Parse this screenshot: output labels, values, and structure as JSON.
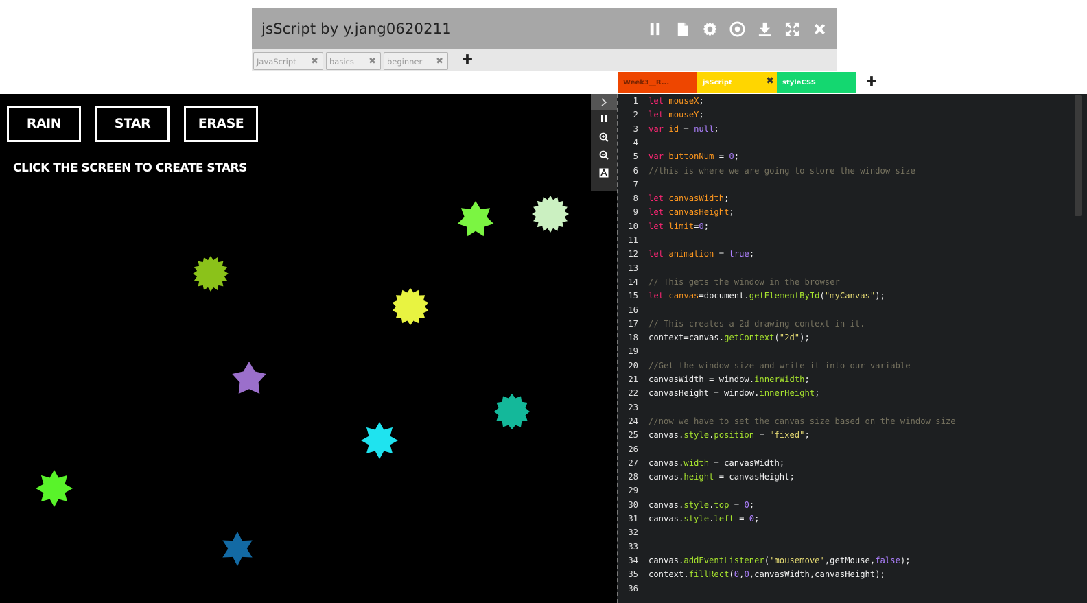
{
  "title": "jsScript by y.jang0620211",
  "title_icons": [
    "pause-icon",
    "file-icon",
    "gear-icon",
    "record-icon",
    "download-icon",
    "fullscreen-icon",
    "close-icon"
  ],
  "tags": [
    {
      "label": "JavaScript",
      "close": "✖"
    },
    {
      "label": "basics",
      "close": "✖"
    },
    {
      "label": "beginner",
      "close": "✖"
    }
  ],
  "tag_add": "✚",
  "file_tabs": [
    {
      "label": "Week3__R...",
      "color": "#ee4600",
      "close": ""
    },
    {
      "label": "jsScript",
      "color": "#ffd600",
      "close": "✖"
    },
    {
      "label": "styleCSS",
      "color": "#14d770",
      "close": ""
    }
  ],
  "file_tab_add": "✚",
  "canvas": {
    "buttons": [
      "RAIN",
      "STAR",
      "ERASE"
    ],
    "hint": "CLICK THE SCREEN TO CREATE STARS",
    "stars": [
      {
        "color": "#7bf542",
        "points": 7
      },
      {
        "color": "#cbf0c1",
        "points": 16
      },
      {
        "color": "#8bc21a",
        "points": 16
      },
      {
        "color": "#e8f341",
        "points": 14
      },
      {
        "color": "#9b6fcb",
        "points": 5
      },
      {
        "color": "#14b89a",
        "points": 12
      },
      {
        "color": "#1fe3ef",
        "points": 8
      },
      {
        "color": "#59f32a",
        "points": 8
      },
      {
        "color": "#136aa4",
        "points": 6
      }
    ]
  },
  "side_tools": [
    "collapse-icon",
    "pause-icon",
    "zoom-in-icon",
    "zoom-out-icon",
    "font-icon"
  ],
  "code_lines": [
    {
      "n": "1",
      "html": "<span class=\"kw\">let</span> <span class=\"vr\">mouseX</span>;"
    },
    {
      "n": "2",
      "html": "<span class=\"kw\">let</span> <span class=\"vr\">mouseY</span>;"
    },
    {
      "n": "3",
      "html": "<span class=\"kw\">var</span> <span class=\"vr\">id</span> = <span class=\"nm\">null</span>;"
    },
    {
      "n": "4",
      "html": ""
    },
    {
      "n": "5",
      "html": "<span class=\"kw\">var</span> <span class=\"vr\">buttonNum</span> = <span class=\"nm\">0</span>;"
    },
    {
      "n": "6",
      "html": "<span class=\"cm\">//this is where we are going to store the window size</span>"
    },
    {
      "n": "7",
      "html": ""
    },
    {
      "n": "8",
      "html": "<span class=\"kw\">let</span> <span class=\"vr\">canvasWidth</span>;"
    },
    {
      "n": "9",
      "html": "<span class=\"kw\">let</span> <span class=\"vr\">canvasHeight</span>;"
    },
    {
      "n": "10",
      "html": "<span class=\"kw\">let</span> <span class=\"vr\">limit</span>=<span class=\"nm\">0</span>;"
    },
    {
      "n": "11",
      "html": ""
    },
    {
      "n": "12",
      "html": "<span class=\"kw\">let</span> <span class=\"vr\">animation</span> = <span class=\"nm\">true</span>;"
    },
    {
      "n": "13",
      "html": ""
    },
    {
      "n": "14",
      "html": "<span class=\"cm\">// This gets the window in the browser</span>"
    },
    {
      "n": "15",
      "html": "<span class=\"kw\">let</span> <span class=\"vr\">canvas</span>=document.<span class=\"fn\">getElementById</span>(<span class=\"st2\">\"myCanvas\"</span>);"
    },
    {
      "n": "16",
      "html": ""
    },
    {
      "n": "17",
      "html": "<span class=\"cm\">// This creates a 2d drawing context in it.</span>"
    },
    {
      "n": "18",
      "html": "context=canvas.<span class=\"fn\">getContext</span>(<span class=\"st2\">\"2d\"</span>);"
    },
    {
      "n": "19",
      "html": ""
    },
    {
      "n": "20",
      "html": "<span class=\"cm\">//Get the window size and write it into our variable</span>"
    },
    {
      "n": "21",
      "html": "canvasWidth = window.<span class=\"fn\">innerWidth</span>;"
    },
    {
      "n": "22",
      "html": "canvasHeight = window.<span class=\"fn\">innerHeight</span>;"
    },
    {
      "n": "23",
      "html": ""
    },
    {
      "n": "24",
      "html": "<span class=\"cm\">//now we have to set the canvas size based on the window size</span>"
    },
    {
      "n": "25",
      "html": "canvas.<span class=\"fn\">style</span>.<span class=\"fn\">position</span> = <span class=\"st2\">\"fixed\"</span>;"
    },
    {
      "n": "26",
      "html": ""
    },
    {
      "n": "27",
      "html": "canvas.<span class=\"fn\">width</span> = canvasWidth;"
    },
    {
      "n": "28",
      "html": "canvas.<span class=\"fn\">height</span> = canvasHeight;"
    },
    {
      "n": "29",
      "html": ""
    },
    {
      "n": "30",
      "html": "canvas.<span class=\"fn\">style</span>.<span class=\"fn\">top</span> = <span class=\"nm\">0</span>;"
    },
    {
      "n": "31",
      "html": "canvas.<span class=\"fn\">style</span>.<span class=\"fn\">left</span> = <span class=\"nm\">0</span>;"
    },
    {
      "n": "32",
      "html": ""
    },
    {
      "n": "33",
      "html": ""
    },
    {
      "n": "34",
      "html": "canvas.<span class=\"fn\">addEventListener</span>(<span class=\"st2\">'mousemove'</span>,getMouse,<span class=\"nm\">false</span>);"
    },
    {
      "n": "35",
      "html": "context.<span class=\"fn\">fillRect</span>(<span class=\"nm\">0</span>,<span class=\"nm\">0</span>,canvasWidth,canvasHeight);"
    },
    {
      "n": "36",
      "html": ""
    }
  ]
}
